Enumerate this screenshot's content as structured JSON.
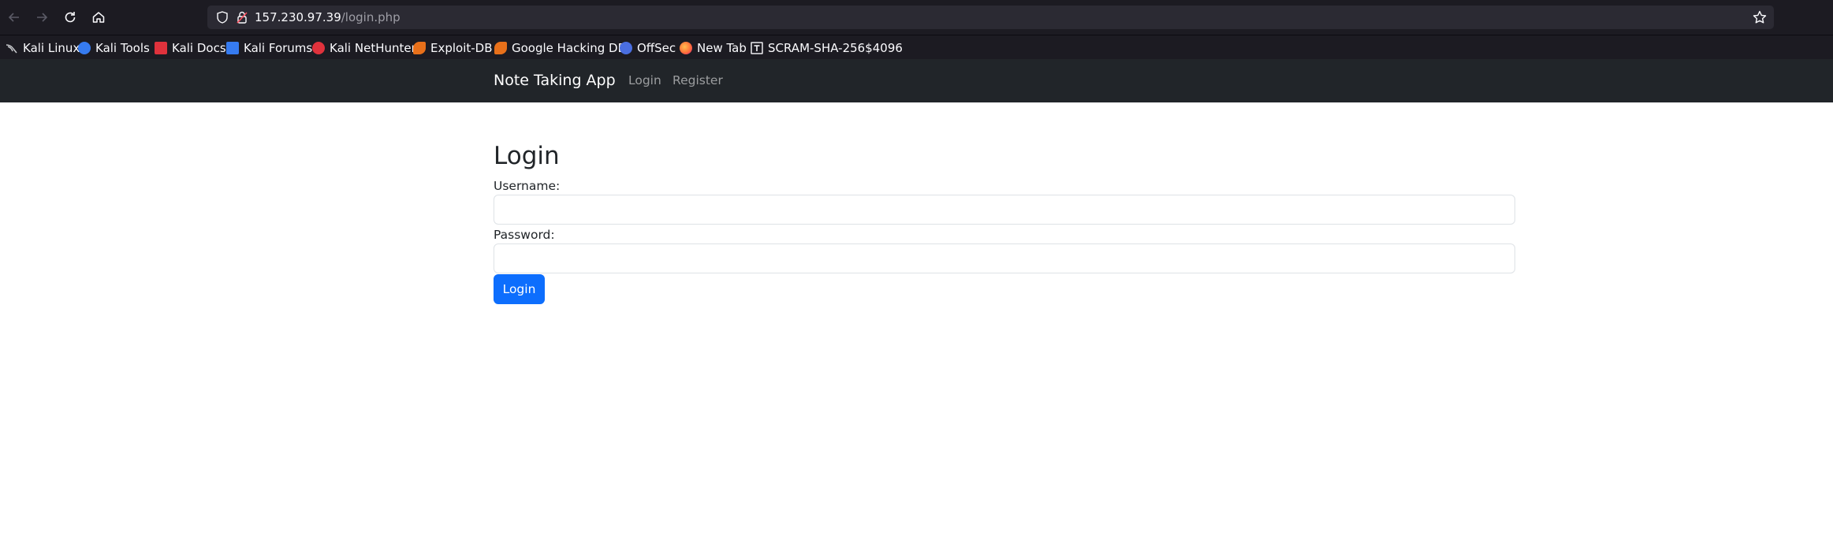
{
  "browser": {
    "url_host": "157.230.97.39",
    "url_path": "/login.php",
    "bookmarks": [
      {
        "label": "Kali Linux",
        "icon": "kali-dragon-icon",
        "color": "#9aa0a6"
      },
      {
        "label": "Kali Tools",
        "icon": "kali-tools-icon",
        "color": "#367bf0"
      },
      {
        "label": "Kali Docs",
        "icon": "kali-docs-icon",
        "color": "#e0323c"
      },
      {
        "label": "Kali Forums",
        "icon": "kali-forums-icon",
        "color": "#367bf0"
      },
      {
        "label": "Kali NetHunter",
        "icon": "kali-nethunter-icon",
        "color": "#e0323c"
      },
      {
        "label": "Exploit-DB",
        "icon": "exploit-db-icon",
        "color": "#e8701a"
      },
      {
        "label": "Google Hacking DB",
        "icon": "ghdb-icon",
        "color": "#e8701a"
      },
      {
        "label": "OffSec",
        "icon": "offsec-icon",
        "color": "#4a6ee0"
      },
      {
        "label": "New Tab",
        "icon": "firefox-icon",
        "color": "#ff7139"
      },
      {
        "label": "SCRAM-SHA-256$4096",
        "icon": "text-bookmark-icon",
        "color": "#ffffff"
      }
    ]
  },
  "app": {
    "brand": "Note Taking App",
    "nav": {
      "login": "Login",
      "register": "Register"
    }
  },
  "login": {
    "title": "Login",
    "username_label": "Username:",
    "username_value": "",
    "password_label": "Password:",
    "password_value": "",
    "submit_label": "Login"
  },
  "colors": {
    "navbar": "#212529",
    "primary": "#0d6efd",
    "browser_chrome": "#1c1b22"
  }
}
